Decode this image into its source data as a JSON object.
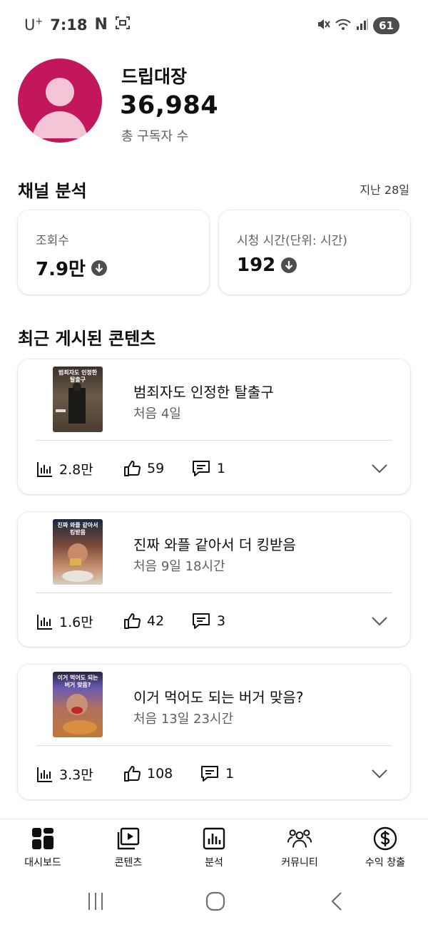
{
  "status_bar": {
    "carrier": "U",
    "carrier_sup": "+",
    "time": "7:18",
    "n_badge": "N",
    "battery": "61"
  },
  "profile": {
    "channel_name": "드립대장",
    "subscriber_count": "36,984",
    "subscriber_label": "총 구독자 수"
  },
  "analytics": {
    "title": "채널 분석",
    "period": "지난 28일",
    "stats": [
      {
        "label": "조회수",
        "value": "7.9만",
        "trend": "down"
      },
      {
        "label": "시청 시간(단위: 시간)",
        "value": "192",
        "trend": "down"
      }
    ]
  },
  "recent": {
    "title": "최근 게시된 콘텐츠",
    "items": [
      {
        "thumb_caption": "범죄자도 인정한 탈출구",
        "title": "범죄자도 인정한 탈출구",
        "age": "처음 4일",
        "views": "2.8만",
        "likes": "59",
        "comments": "1"
      },
      {
        "thumb_caption": "진짜 와플 같아서 킹받음",
        "title": "진짜 와플 같아서 더 킹받음",
        "age": "처음 9일 18시간",
        "views": "1.6만",
        "likes": "42",
        "comments": "3"
      },
      {
        "thumb_caption": "이거 먹어도 되는 버거 맞음?",
        "title": "이거 먹어도 되는 버거 맞음?",
        "age": "처음 13일 23시간",
        "views": "3.3만",
        "likes": "108",
        "comments": "1"
      }
    ]
  },
  "bottom_nav": [
    {
      "label": "대시보드",
      "icon": "dashboard-icon"
    },
    {
      "label": "콘텐츠",
      "icon": "content-icon"
    },
    {
      "label": "분석",
      "icon": "analytics-icon"
    },
    {
      "label": "커뮤니티",
      "icon": "community-icon"
    },
    {
      "label": "수익 창출",
      "icon": "monetization-icon"
    }
  ],
  "colors": {
    "avatar_bg": "#c2185b",
    "avatar_figure": "#f3c3d6",
    "text_primary": "#0f0f0f",
    "text_secondary": "#606060"
  }
}
